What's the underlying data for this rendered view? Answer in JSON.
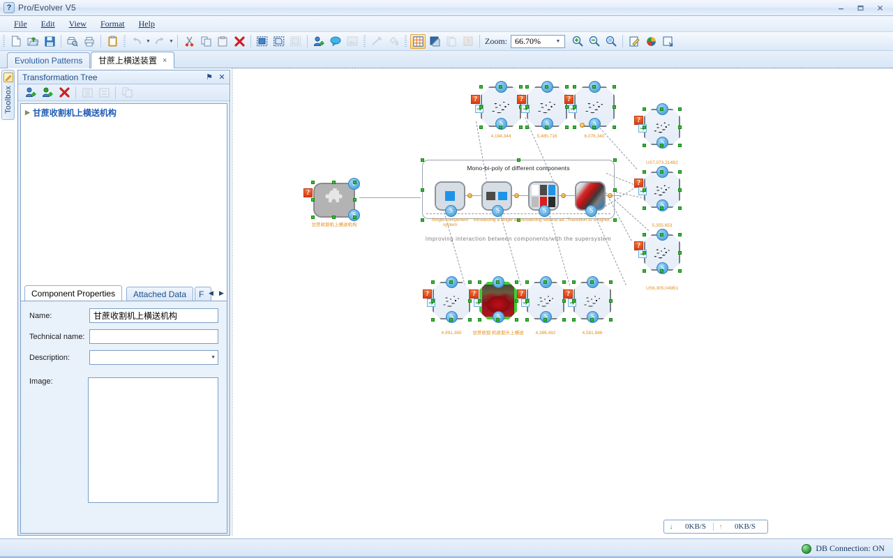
{
  "window": {
    "title": "Pro/Evolver V5",
    "app_icon": "question-app-icon",
    "minimize": "–",
    "maximize": "❐",
    "close": "×"
  },
  "menu": {
    "items": [
      {
        "label": "File",
        "accel": "F"
      },
      {
        "label": "Edit",
        "accel": "E"
      },
      {
        "label": "View",
        "accel": "V"
      },
      {
        "label": "Format",
        "accel": "o"
      },
      {
        "label": "Help",
        "accel": "H"
      }
    ]
  },
  "toolbar": {
    "zoom_label": "Zoom:",
    "zoom_value": "66.70%",
    "groups": [
      {
        "buttons": [
          {
            "name": "new-document",
            "icon": "page"
          },
          {
            "name": "open-document",
            "icon": "folder-open"
          },
          {
            "name": "save-document",
            "icon": "floppy"
          }
        ]
      },
      {
        "buttons": [
          {
            "name": "print-preview",
            "icon": "print-preview"
          },
          {
            "name": "print",
            "icon": "printer"
          }
        ]
      },
      {
        "buttons": [
          {
            "name": "clipboard-report",
            "icon": "clipboard"
          }
        ]
      },
      {
        "buttons": [
          {
            "name": "undo",
            "icon": "undo",
            "dropdown": true
          },
          {
            "name": "redo",
            "icon": "redo",
            "dropdown": true
          }
        ]
      },
      {
        "buttons": [
          {
            "name": "cut",
            "icon": "scissors"
          },
          {
            "name": "copy",
            "icon": "copy"
          },
          {
            "name": "paste",
            "icon": "paste"
          },
          {
            "name": "delete",
            "icon": "red-x"
          }
        ]
      },
      {
        "buttons": [
          {
            "name": "select-all",
            "icon": "select-all"
          },
          {
            "name": "select-area",
            "icon": "select-area"
          },
          {
            "name": "deselect",
            "icon": "deselect",
            "disabled": true
          }
        ]
      },
      {
        "buttons": [
          {
            "name": "add-component",
            "icon": "add-person"
          },
          {
            "name": "add-comment",
            "icon": "speech-bubble"
          },
          {
            "name": "add-image",
            "icon": "image",
            "disabled": true
          }
        ]
      },
      {
        "buttons": [
          {
            "name": "draw-link",
            "icon": "pencil-line",
            "disabled": true
          },
          {
            "name": "fill-color",
            "icon": "paint-bucket",
            "disabled": true
          }
        ]
      },
      {
        "buttons": [
          {
            "name": "toggle-grid",
            "icon": "grid",
            "active": true
          },
          {
            "name": "toggle-shadow",
            "icon": "shadow-square"
          },
          {
            "name": "page-setup",
            "icon": "page-setup",
            "disabled": true
          },
          {
            "name": "show-help-markers",
            "icon": "help-marker",
            "disabled": true
          }
        ]
      },
      {
        "buttons": [
          {
            "name": "zoom-in",
            "icon": "magnifier-plus"
          },
          {
            "name": "zoom-out",
            "icon": "magnifier-minus"
          },
          {
            "name": "zoom-fit",
            "icon": "magnifier-fit"
          }
        ]
      },
      {
        "buttons": [
          {
            "name": "edit-notes",
            "icon": "note-pencil"
          },
          {
            "name": "color-wheel",
            "icon": "color-wheel"
          },
          {
            "name": "resize-window",
            "icon": "resize"
          }
        ]
      }
    ]
  },
  "tabs": [
    {
      "label": "Evolution Patterns",
      "selected": false,
      "closable": false
    },
    {
      "label": "甘蔗上横送装置",
      "selected": true,
      "closable": true,
      "close_glyph": "×"
    }
  ],
  "toolbox_strip": {
    "label": "Toolbox",
    "icon": "pencil-icon"
  },
  "transformation_tree": {
    "title": "Transformation Tree",
    "pin_glyph": "⚑",
    "close_glyph": "✕",
    "toolbar_buttons": [
      {
        "name": "add-node",
        "icon": "add-node-green"
      },
      {
        "name": "add-variant",
        "icon": "add-variant-green"
      },
      {
        "name": "delete-node",
        "icon": "delete-red-x"
      },
      {
        "name": "expand-all",
        "icon": "expand-tree",
        "disabled": true
      },
      {
        "name": "collapse-all",
        "icon": "collapse-tree",
        "disabled": true
      },
      {
        "name": "duplicate-node",
        "icon": "duplicate",
        "disabled": true
      }
    ],
    "root_node": {
      "label": "甘蔗收割机上横送机构",
      "expander": "▶"
    }
  },
  "properties": {
    "tabs": [
      {
        "label": "Component Properties",
        "selected": true
      },
      {
        "label": "Attached Data",
        "selected": false
      },
      {
        "label": "F",
        "selected": false
      }
    ],
    "nav_prev": "◀",
    "nav_next": "▶",
    "fields": [
      {
        "label": "Name:",
        "value": "甘蔗收割机上横送机构",
        "placeholder": ""
      },
      {
        "label": "Technical name:",
        "value": "",
        "placeholder": ""
      },
      {
        "label": "Description:",
        "value": "",
        "placeholder": "",
        "dropdown": true,
        "dropdown_glyph": "▼"
      }
    ],
    "image_label": "Image:",
    "image_value": ""
  },
  "canvas": {
    "group": {
      "title": "Mono-bi-poly of different  components",
      "footer": "Improving   interaction   between   components/with   the   supersystem"
    },
    "root_node": {
      "label": "甘蔗收割机上横送机构",
      "badge_e": "e",
      "badge_s": "S",
      "qmark": "?"
    },
    "pattern_nodes": [
      {
        "label": "Single-component\nsystem",
        "badge_s": "S",
        "thumb": "single-square"
      },
      {
        "label": "Introducing a\nsingle a...",
        "badge_s": "S",
        "thumb": "two-squares"
      },
      {
        "label": "Introducing\nseveral ad...",
        "badge_s": "S",
        "thumb": "grid-squares"
      },
      {
        "label": "Transition to a\nhigher...",
        "badge_s": "S",
        "thumb": "stripe"
      }
    ],
    "top_nodes": [
      {
        "label": "4,194,344",
        "badge_e": "e",
        "badge_s": "S",
        "qmark": "?"
      },
      {
        "label": "5,485,716",
        "badge_e": "e",
        "badge_s": "S",
        "qmark": "?"
      },
      {
        "label": "6,076,340",
        "badge_e": "e",
        "badge_s": "S",
        "qmark": "?"
      }
    ],
    "right_nodes": [
      {
        "label": "US7,073,314B2",
        "badge_e": "e",
        "badge_s": "S",
        "qmark": "?"
      },
      {
        "label": "5,355,653",
        "badge_e": "e",
        "badge_s": "S",
        "qmark": "?"
      },
      {
        "label": "US6,305,049B1",
        "badge_e": "e",
        "badge_s": "S",
        "qmark": "?"
      }
    ],
    "bottom_nodes": [
      {
        "label": "4,991,385",
        "badge_e": "e",
        "badge_s": "S",
        "qmark": "?",
        "selected": false
      },
      {
        "label": "甘蔗收割\n机收割头上横送",
        "badge_e": "e",
        "badge_s": "S",
        "qmark": "?",
        "selected": true
      },
      {
        "label": "4,386,492",
        "badge_e": "e",
        "badge_s": "S",
        "qmark": "?",
        "selected": false
      },
      {
        "label": "4,581,886",
        "badge_e": "e",
        "badge_s": "S",
        "qmark": "?",
        "selected": false
      }
    ]
  },
  "netmeter": {
    "down_glyph": "↓",
    "down_value": "0KB/S",
    "up_glyph": "↑",
    "up_value": "0KB/S"
  },
  "statusbar": {
    "db_label": "DB Connection: ON",
    "db_icon": "globe-icon"
  },
  "colors": {
    "accent": "#1f5bb5",
    "label_orange": "#e09020",
    "badge_blue": "#3a9ad9",
    "qmark_red": "#d93b12",
    "handle_green": "#31c131"
  }
}
